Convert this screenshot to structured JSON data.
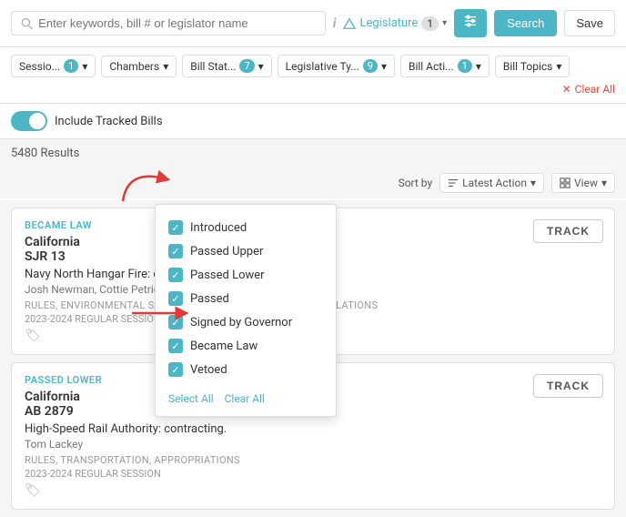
{
  "search": {
    "placeholder": "Enter keywords, bill # or legislator name",
    "info_label": "i",
    "legislature_label": "Legislature",
    "legislature_num": "1",
    "filter_icon": "≡",
    "search_label": "Search",
    "save_label": "Save"
  },
  "filters": {
    "session_label": "Sessio...",
    "session_count": "1",
    "chambers_label": "Chambers",
    "billstat_label": "Bill Stat...",
    "billstat_count": "7",
    "legtype_label": "Legislative Ty...",
    "legtype_count": "9",
    "billaction_label": "Bill Acti...",
    "billaction_count": "1",
    "billtopics_label": "Bill Topics",
    "clear_all_label": "Clear All"
  },
  "toggle": {
    "label": "Include Tracked Bills"
  },
  "results": {
    "count_label": "5480 Results"
  },
  "dropdown": {
    "items": [
      {
        "label": "Introduced",
        "checked": true
      },
      {
        "label": "Passed Upper",
        "checked": true
      },
      {
        "label": "Passed Lower",
        "checked": true
      },
      {
        "label": "Passed",
        "checked": true
      },
      {
        "label": "Signed by Governor",
        "checked": true
      },
      {
        "label": "Became Law",
        "checked": true
      },
      {
        "label": "Vetoed",
        "checked": true
      }
    ],
    "select_all_label": "Select All",
    "clear_label": "Clear All"
  },
  "sort_bar": {
    "sort_by_label": "Sort by",
    "latest_action_label": "Latest Action",
    "view_label": "View"
  },
  "bills": [
    {
      "status": "BECAME LAW",
      "status_class": "became-law",
      "state": "California",
      "number": "SJR 13",
      "title": "Navy North Hangar Fire: contamin",
      "authors": "Josh Newman, Cottie Petrie-Norris",
      "topics": "RULES, ENVIRONMENTAL SAFETY AND ...",
      "extra_topics": "FUEL EMISSIONS, REGULATIONS",
      "session": "2023-2024 REGULAR SESSION",
      "track_label": "TRACK"
    },
    {
      "status": "PASSED LOWER",
      "status_class": "passed-lower",
      "state": "California",
      "number": "AB 2879",
      "title": "High-Speed Rail Authority: contracting.",
      "authors": "Tom Lackey",
      "topics": "RULES, TRANSPORTATION, APPROPRIATIONS",
      "extra_topics": "",
      "session": "2023-2024 REGULAR SESSION",
      "track_label": "TRACK"
    }
  ]
}
